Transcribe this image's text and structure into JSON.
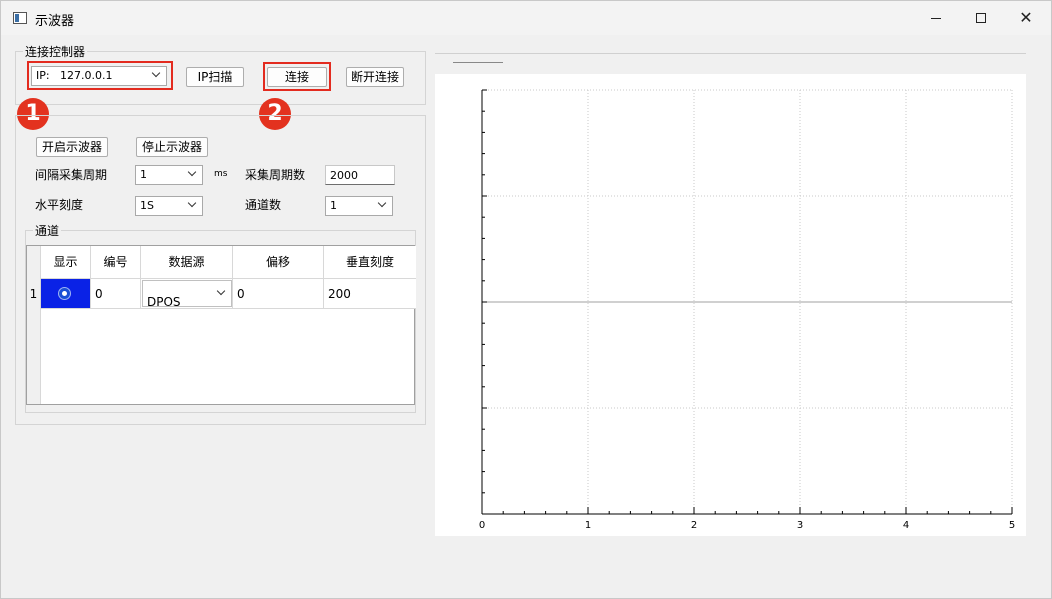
{
  "window": {
    "title": "示波器"
  },
  "controller": {
    "group_title": "连接控制器",
    "ip_label": "IP:",
    "ip_value": "127.0.0.1",
    "scan_button": "IP扫描",
    "connect_button": "连接",
    "disconnect_button": "断开连接"
  },
  "annotations": {
    "step1": "1",
    "step2": "2"
  },
  "scope": {
    "start_button": "开启示波器",
    "stop_button": "停止示波器",
    "interval_label": "间隔采集周期",
    "interval_value": "1",
    "interval_unit": "ms",
    "sample_count_label": "采集周期数",
    "sample_count_value": "2000",
    "horizontal_label": "水平刻度",
    "horizontal_value": "1S",
    "channel_count_label": "通道数",
    "channel_count_value": "1"
  },
  "channels": {
    "group_title": "通道",
    "headers": [
      "显示",
      "编号",
      "数据源",
      "偏移",
      "垂直刻度"
    ],
    "rows": [
      {
        "row": "1",
        "id": "0",
        "source": "DPOS",
        "offset": "0",
        "vscale": "200"
      }
    ]
  },
  "chart_data": {
    "type": "line",
    "series": [],
    "xlim": [
      0,
      5
    ],
    "xticks": [
      "0",
      "1",
      "2",
      "3",
      "4",
      "5"
    ],
    "grid": true,
    "grid_style": "dotted",
    "colors": {
      "axis": "#000000",
      "grid": "#c8c8c8",
      "zero_line": "#a0a0a0"
    }
  }
}
